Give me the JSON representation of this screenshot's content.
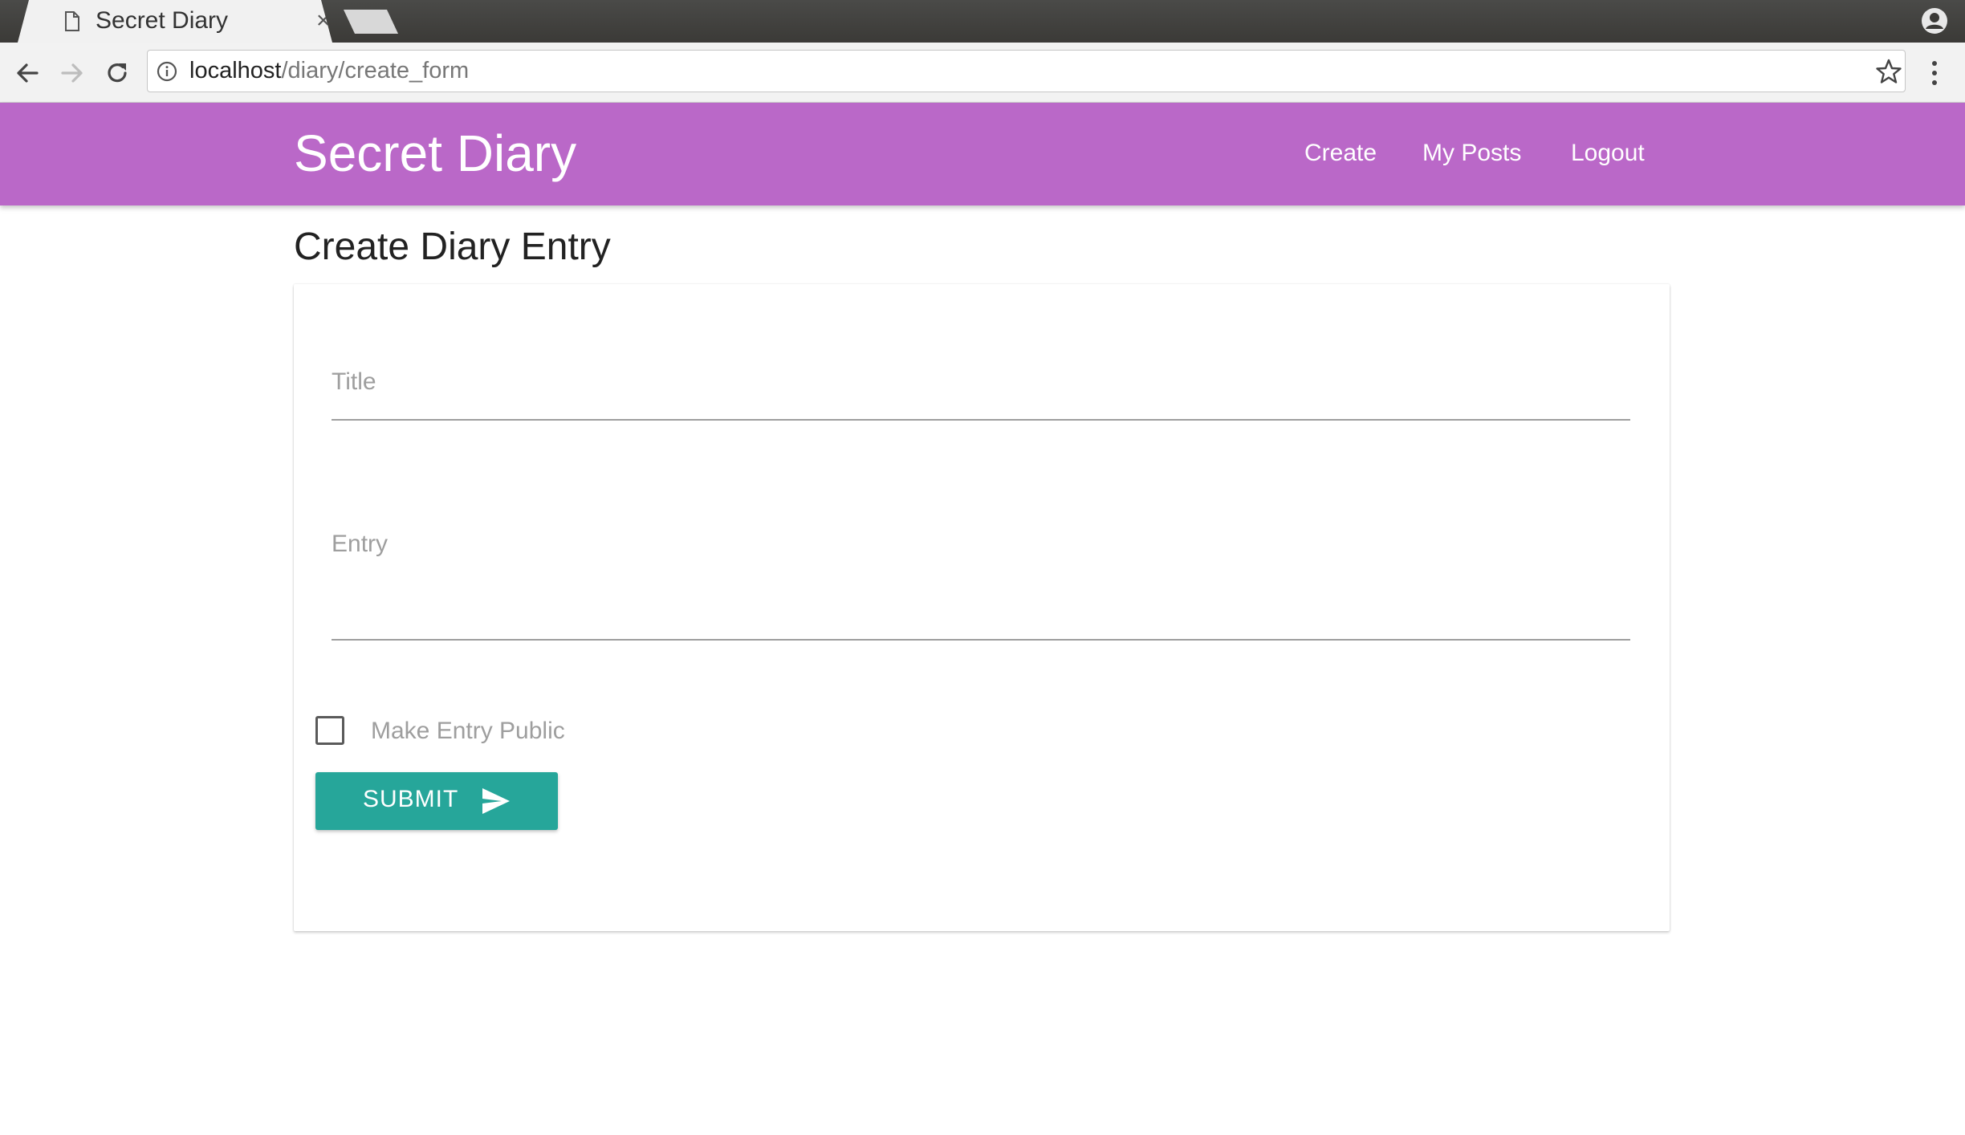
{
  "browser": {
    "tab": {
      "title": "Secret Diary",
      "close_glyph": "×"
    },
    "url": {
      "host": "localhost",
      "path": "/diary/create_form"
    },
    "icons": [
      "document-icon",
      "close-icon",
      "new-tab-icon",
      "profile-icon",
      "back-icon",
      "forward-icon",
      "reload-icon",
      "info-icon",
      "star-icon",
      "menu-icon"
    ]
  },
  "app": {
    "brand": "Secret Diary",
    "nav": [
      {
        "label": "Create"
      },
      {
        "label": "My Posts"
      },
      {
        "label": "Logout"
      }
    ]
  },
  "form": {
    "heading": "Create Diary Entry",
    "title_field": {
      "label": "Title",
      "value": ""
    },
    "entry_field": {
      "label": "Entry",
      "value": ""
    },
    "public_checkbox": {
      "label": "Make Entry Public",
      "checked": false
    },
    "submit": {
      "label": "SUBMIT",
      "icon": "send-icon"
    }
  },
  "colors": {
    "appbar": "#ba68c8",
    "submit": "#26a69a"
  }
}
